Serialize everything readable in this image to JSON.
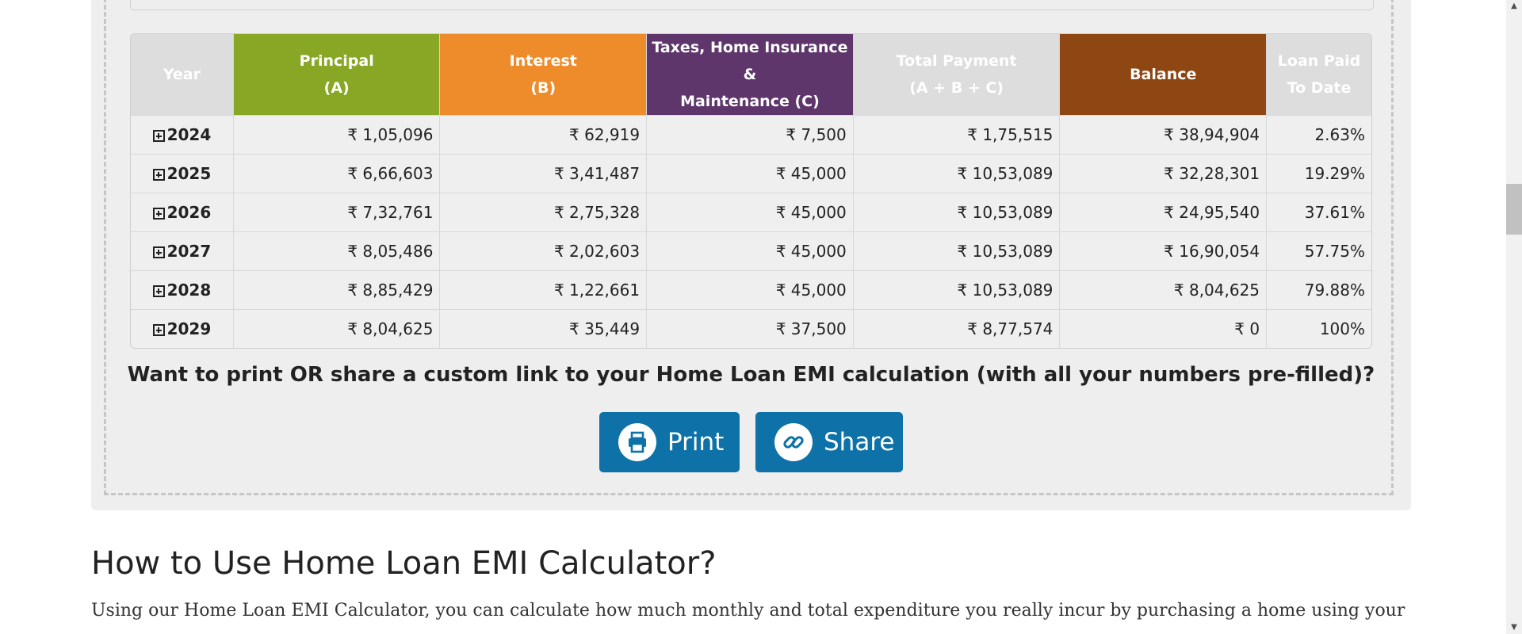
{
  "table": {
    "headers": {
      "year": "Year",
      "principal_1": "Principal",
      "principal_2": "(A)",
      "interest_1": "Interest",
      "interest_2": "(B)",
      "taxes_1": "Taxes, Home Insurance &",
      "taxes_2": "Maintenance (C)",
      "total_1": "Total Payment",
      "total_2": "(A + B + C)",
      "balance": "Balance",
      "paid_1": "Loan Paid",
      "paid_2": "To Date"
    },
    "rows": [
      {
        "year": "2024",
        "principal": "₹ 1,05,096",
        "interest": "₹ 62,919",
        "taxes": "₹ 7,500",
        "total": "₹ 1,75,515",
        "balance": "₹ 38,94,904",
        "paid": "2.63%"
      },
      {
        "year": "2025",
        "principal": "₹ 6,66,603",
        "interest": "₹ 3,41,487",
        "taxes": "₹ 45,000",
        "total": "₹ 10,53,089",
        "balance": "₹ 32,28,301",
        "paid": "19.29%"
      },
      {
        "year": "2026",
        "principal": "₹ 7,32,761",
        "interest": "₹ 2,75,328",
        "taxes": "₹ 45,000",
        "total": "₹ 10,53,089",
        "balance": "₹ 24,95,540",
        "paid": "37.61%"
      },
      {
        "year": "2027",
        "principal": "₹ 8,05,486",
        "interest": "₹ 2,02,603",
        "taxes": "₹ 45,000",
        "total": "₹ 10,53,089",
        "balance": "₹ 16,90,054",
        "paid": "57.75%"
      },
      {
        "year": "2028",
        "principal": "₹ 8,85,429",
        "interest": "₹ 1,22,661",
        "taxes": "₹ 45,000",
        "total": "₹ 10,53,089",
        "balance": "₹ 8,04,625",
        "paid": "79.88%"
      },
      {
        "year": "2029",
        "principal": "₹ 8,04,625",
        "interest": "₹ 35,449",
        "taxes": "₹ 37,500",
        "total": "₹ 8,77,574",
        "balance": "₹ 0",
        "paid": "100%"
      }
    ],
    "colors": {
      "principal": "#88a825",
      "interest": "#ee8c2c",
      "taxes": "#5e366b",
      "balance": "#8e4612"
    }
  },
  "share": {
    "question": "Want to print OR share a custom link to your Home Loan EMI calculation (with all your numbers pre-filled)?",
    "print_label": "Print",
    "share_label": "Share",
    "print_icon": "printer-icon",
    "share_icon": "link-icon",
    "button_color": "#0e72a8"
  },
  "section": {
    "title": "How to Use Home Loan EMI Calculator?",
    "text": "Using our Home Loan EMI Calculator, you can calculate how much monthly and total expenditure you really incur by purchasing a home using your"
  }
}
